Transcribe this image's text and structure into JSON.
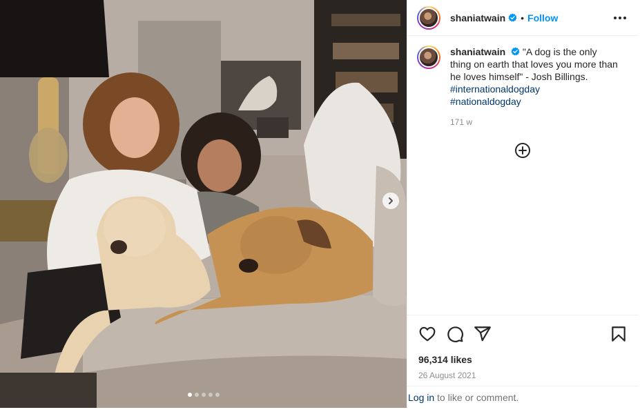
{
  "post": {
    "username": "shaniatwain",
    "verified": true,
    "follow_label": "Follow",
    "separator": "•",
    "caption_text": "\"A dog is the only thing on earth that loves you more than he loves himself\" - Josh Billings.",
    "hashtags": [
      "#internationaldogday",
      "#nationaldogday"
    ],
    "time_ago": "171 w",
    "likes": "96,314 likes",
    "date": "26 August 2021"
  },
  "carousel": {
    "total": 5,
    "active": 1
  },
  "login": {
    "link": "Log in",
    "text": " to like or comment."
  },
  "icons": {
    "more": "more-options-icon",
    "verified": "verified-badge-icon",
    "add_comment": "add-circle-icon",
    "like": "heart-icon",
    "comment": "comment-icon",
    "share": "send-icon",
    "save": "bookmark-icon",
    "next": "chevron-right-icon"
  },
  "colors": {
    "accent": "#0095f6",
    "hashtag": "#00376b",
    "verified": "#0095f6"
  }
}
